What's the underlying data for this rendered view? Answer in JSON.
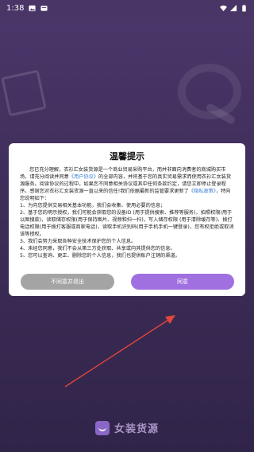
{
  "status_bar": {
    "time": "1:38",
    "icons_left": [
      "gallery-icon",
      "card-icon"
    ],
    "icons_right": [
      "wifi-icon",
      "signal-icon",
      "battery-icon"
    ]
  },
  "splash": {
    "brand_name": "女装货源"
  },
  "dialog": {
    "title": "温馨提示",
    "intro_1": "您已充分理解，衣衫汇女装货源是一个商业贸易采购平台，而并非面向消费者的商城购买市场，请充分阅读并同意",
    "user_agreement_link": "《用户协议》",
    "intro_2": "的全部内容，并将基于您的真实贸易需求而使用衣衫汇女装货源服务。阅读协议的过程中，如果您不同意相关协议或其中任何条款约定，请您立即停止登录程序。感谢您对衣衫汇女装货源一直以来的信任!我们依据最新的监管要求更新了",
    "privacy_policy_link": "《隐私政策》",
    "intro_3": "，特向您说明如下：",
    "items": [
      "1、为向您提供交易相关基本功能，我们会收集、使用必要的信息；",
      "2、基于您的明示授权，我们可能会获取您的设备ID (用于提供搜索、推荐等服务)，拍照权限(用于以图搜款)，读取储存权限(用于保持图片、视频和扫一扫)，写入储存权限 (用于清除缓存等)、拨打电话权限(用于拨打客服或商家电话)，读取手机识别码(用于手机手机一键登录)，您有权拒绝或取消该等授权。",
      "3、我们会努力采取各种安全技术保护您的个人信息。",
      "4、未经您同意，我们不会从第三方处获取、共享或向其提供您的信息。",
      "5、您可以查询、更正、删除您的个人信息，我们也提供账户注销的渠道。"
    ],
    "decline_label": "不同意并退出",
    "agree_label": "同意"
  },
  "colors": {
    "accent": "#a070e0",
    "decline": "#a4a4a4",
    "link": "#3a7bd5",
    "annotation_arrow": "#e0463c"
  }
}
